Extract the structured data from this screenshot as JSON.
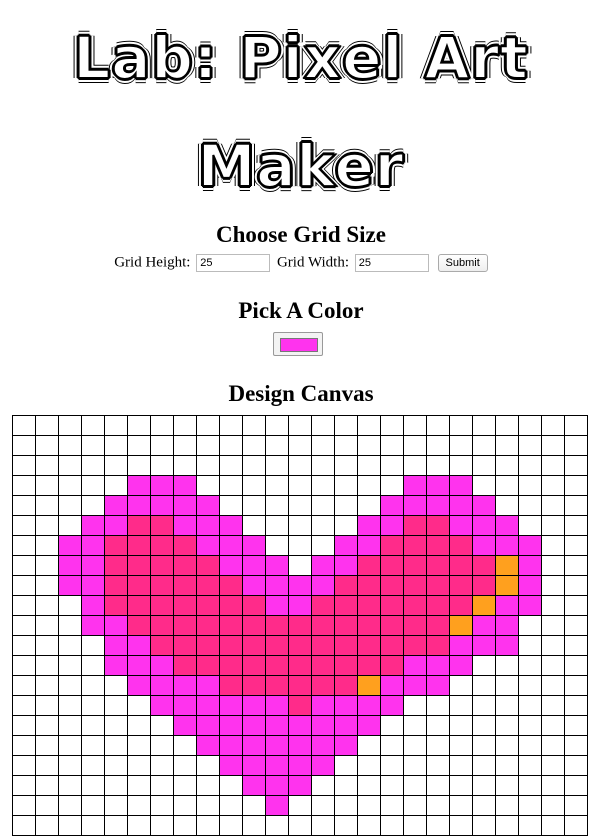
{
  "header": {
    "title_line1": "Lab: Pixel Art",
    "title_line2": "Maker"
  },
  "grid_section": {
    "heading": "Choose Grid Size",
    "height_label": "Grid Height:",
    "height_value": "25",
    "width_label": "Grid Width:",
    "width_value": "25",
    "submit_label": "Submit"
  },
  "color_section": {
    "heading": "Pick A Color",
    "selected_color": "#ff33ee"
  },
  "canvas_section": {
    "heading": "Design Canvas"
  },
  "canvas": {
    "columns": 25,
    "rows_visible": 21,
    "colors": {
      "M": "#ff33ee",
      "R": "#ff2b8a",
      "O": "#ffa01e"
    },
    "pixels": [
      ".........................",
      ".........................",
      "..........................",
      ".....MMM.........MMM.....",
      "....MMMMM.......MMMMM....",
      "...MMRRMMM.....MMRRMMM...",
      "..MMRRRRMMM...MMRRRRMMM..",
      "..MMRRRRRMMM.MMRRRRRROM..",
      "..MMRRRRRRMMMMRRRRRRROM..",
      "...MRRRRRRRMMRRRRRRROMM..",
      "...MMRRRRRRRRRRRRRROMM...",
      "....MMRRRRRRRRRRRRRMMM...",
      "....MMMRRRRRRRRRRMMM.....",
      ".....MMMMRRRRRROMMM......",
      "......MMMMMMRMMMM........",
      ".......MMMMMMMMM.........",
      "........MMMMMMM..........",
      ".........MMMMM...........",
      "..........MMM............",
      "...........M.............",
      "........................."
    ]
  }
}
